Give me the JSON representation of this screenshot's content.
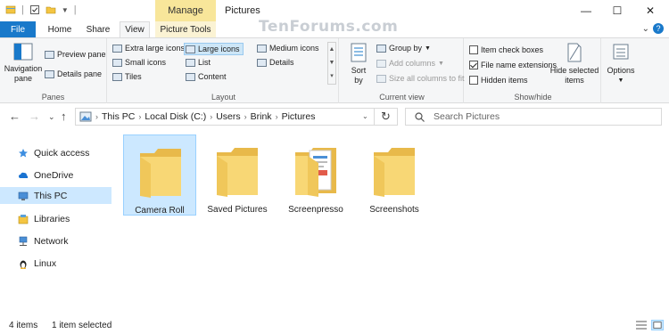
{
  "window": {
    "context_tab_label": "Manage",
    "title": "Pictures",
    "minimize": "—",
    "maximize": "☐",
    "close": "✕"
  },
  "watermark": "TenForums.com",
  "tabs": {
    "file": "File",
    "home": "Home",
    "share": "Share",
    "view": "View",
    "picture_tools": "Picture Tools",
    "help": "?"
  },
  "ribbon": {
    "panes": {
      "label": "Panes",
      "navigation_pane": "Navigation pane",
      "preview_pane": "Preview pane",
      "details_pane": "Details pane"
    },
    "layout": {
      "label": "Layout",
      "items": {
        "extra_large": "Extra large icons",
        "large": "Large icons",
        "medium": "Medium icons",
        "small": "Small icons",
        "list": "List",
        "details": "Details",
        "tiles": "Tiles",
        "content": "Content"
      },
      "selected": "Large icons"
    },
    "current_view": {
      "label": "Current view",
      "sort_by": "Sort by",
      "group_by": "Group by",
      "add_columns": "Add columns",
      "size_columns": "Size all columns to fit"
    },
    "show_hide": {
      "label": "Show/hide",
      "item_check_boxes": "Item check boxes",
      "item_check_boxes_checked": false,
      "file_name_extensions": "File name extensions",
      "file_name_extensions_checked": true,
      "hidden_items": "Hidden items",
      "hidden_items_checked": false,
      "hide_selected": "Hide selected items"
    },
    "options": {
      "label": "Options"
    }
  },
  "address": {
    "crumbs": [
      "This PC",
      "Local Disk (C:)",
      "Users",
      "Brink",
      "Pictures"
    ],
    "search_placeholder": "Search Pictures"
  },
  "nav": {
    "items": [
      {
        "label": "Quick access",
        "icon": "star-icon"
      },
      {
        "label": "OneDrive",
        "icon": "cloud-icon"
      },
      {
        "label": "This PC",
        "icon": "computer-icon",
        "selected": true
      },
      {
        "label": "Libraries",
        "icon": "library-icon"
      },
      {
        "label": "Network",
        "icon": "network-icon"
      },
      {
        "label": "Linux",
        "icon": "penguin-icon"
      }
    ]
  },
  "files": [
    {
      "name": "Camera Roll",
      "selected": true,
      "variant": "plain"
    },
    {
      "name": "Saved Pictures",
      "selected": false,
      "variant": "plain"
    },
    {
      "name": "Screenpresso",
      "selected": false,
      "variant": "docs"
    },
    {
      "name": "Screenshots",
      "selected": false,
      "variant": "plain"
    }
  ],
  "status": {
    "count": "4 items",
    "selection": "1 item selected"
  },
  "colors": {
    "accent": "#1979ca",
    "folder": "#f8d775",
    "selection": "#cce8ff"
  }
}
